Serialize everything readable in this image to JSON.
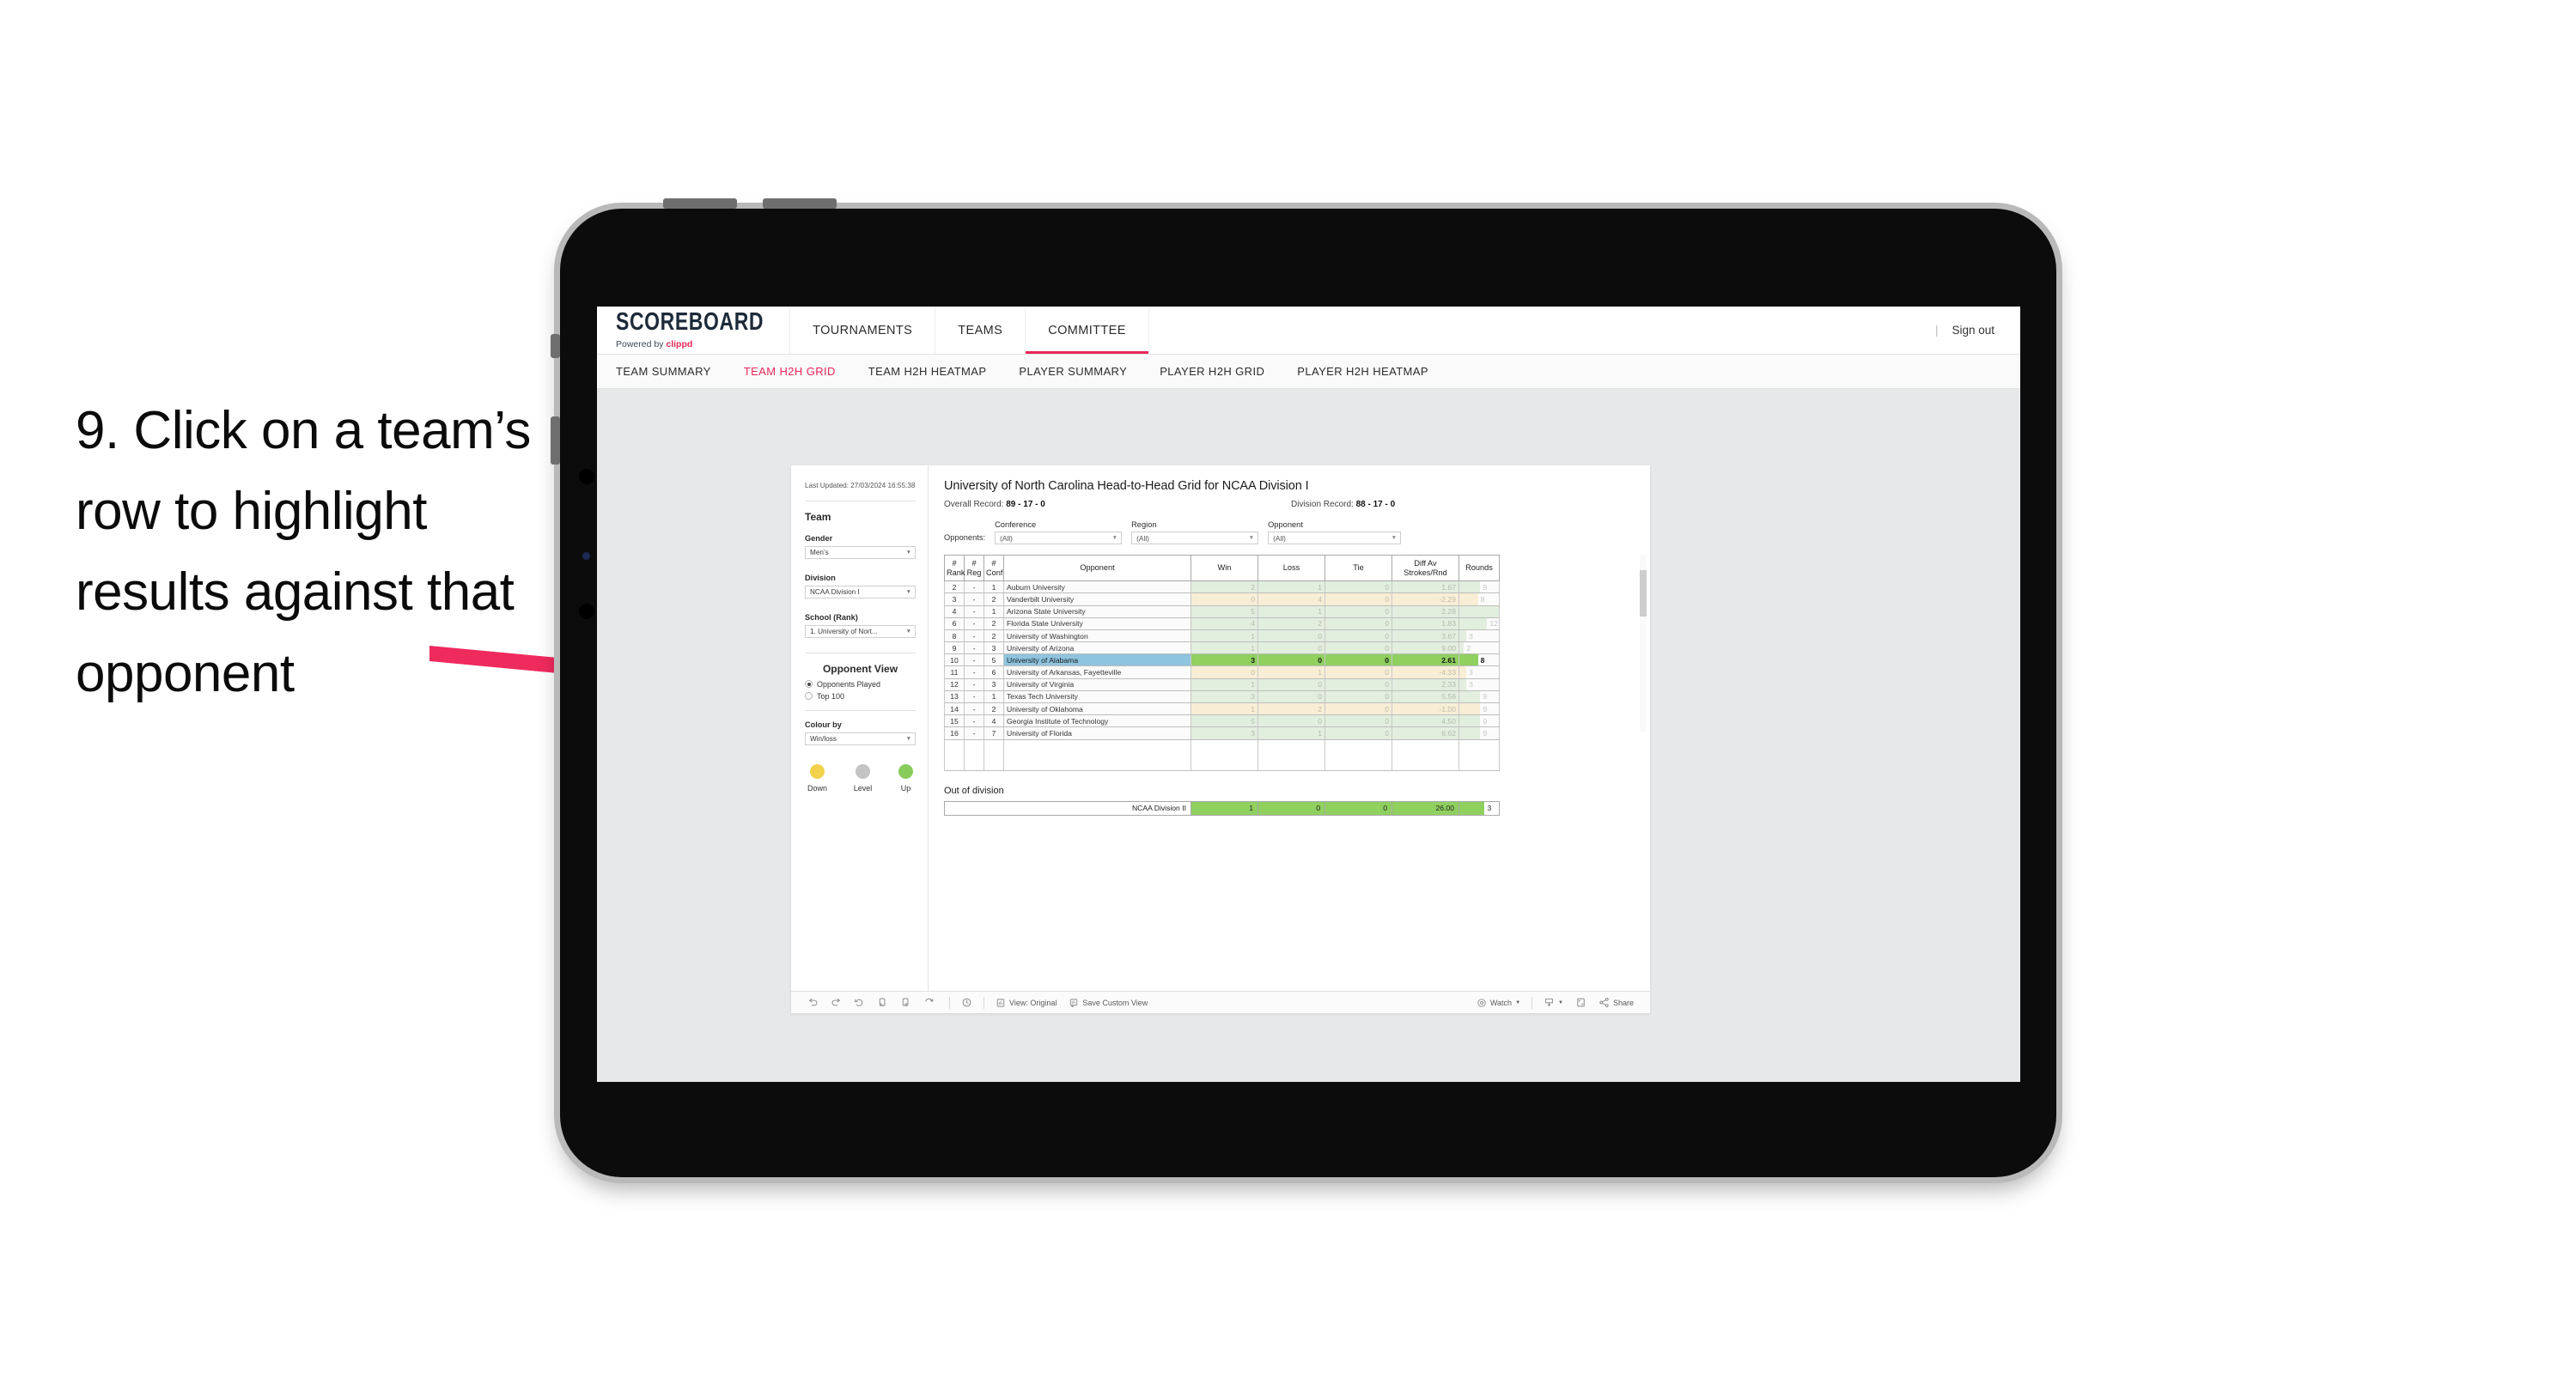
{
  "instruction": {
    "text": "9. Click on a team’s row to highlight results against that opponent",
    "arrow_color": "#ef2a5d"
  },
  "app": {
    "brand": {
      "title": "SCOREBOARD",
      "sub_prefix": "Powered by ",
      "sub_accent": "clippd"
    },
    "top_nav": [
      {
        "label": "TOURNAMENTS",
        "active": false
      },
      {
        "label": "TEAMS",
        "active": false
      },
      {
        "label": "COMMITTEE",
        "active": true
      }
    ],
    "sign_out": "Sign out",
    "divider": "|",
    "sub_nav": [
      {
        "label": "TEAM SUMMARY",
        "active": false
      },
      {
        "label": "TEAM H2H GRID",
        "active": true
      },
      {
        "label": "TEAM H2H HEATMAP",
        "active": false
      },
      {
        "label": "PLAYER SUMMARY",
        "active": false
      },
      {
        "label": "PLAYER H2H GRID",
        "active": false
      },
      {
        "label": "PLAYER H2H HEATMAP",
        "active": false
      }
    ]
  },
  "sidebar": {
    "last_updated": "Last Updated: 27/03/2024 16:55:38",
    "team_heading": "Team",
    "gender_label": "Gender",
    "gender_value": "Men’s",
    "division_label": "Division",
    "division_value": "NCAA Division I",
    "school_label": "School (Rank)",
    "school_value": "1. University of Nort...",
    "opponent_view_heading": "Opponent View",
    "opponent_view_options": [
      {
        "label": "Opponents Played",
        "selected": true
      },
      {
        "label": "Top 100",
        "selected": false
      }
    ],
    "colour_by_label": "Colour by",
    "colour_by_value": "Win/loss",
    "legend": [
      {
        "label": "Down",
        "color": "#f2d24b"
      },
      {
        "label": "Level",
        "color": "#c4c4c4"
      },
      {
        "label": "Up",
        "color": "#89cc5c"
      }
    ]
  },
  "main": {
    "title": "University of North Carolina Head-to-Head Grid for NCAA Division I",
    "overall_record_label": "Overall Record: ",
    "overall_record_value": "89 - 17 - 0",
    "division_record_label": "Division Record: ",
    "division_record_value": "88 - 17 - 0",
    "opponents_label": "Opponents:",
    "filters": [
      {
        "label": "Conference",
        "value": "(All)"
      },
      {
        "label": "Region",
        "value": "(All)"
      },
      {
        "label": "Opponent",
        "value": "(All)"
      }
    ]
  },
  "chart_data": {
    "type": "table",
    "title": "University of North Carolina Head-to-Head Grid for NCAA Division I",
    "columns": [
      "# Rank",
      "# Reg",
      "# Conf",
      "Opponent",
      "Win",
      "Loss",
      "Tie",
      "Diff Av Strokes/Rnd",
      "Rounds"
    ],
    "rounds_axis_max": 17,
    "rows": [
      {
        "rank": "2",
        "reg": "-",
        "conf": "1",
        "opponent": "Auburn University",
        "win": "2",
        "loss": "1",
        "tie": "0",
        "diff": "1.67",
        "rounds": 9,
        "tone": "up",
        "highlighted": false
      },
      {
        "rank": "3",
        "reg": "-",
        "conf": "2",
        "opponent": "Vanderbilt University",
        "win": "0",
        "loss": "4",
        "tie": "0",
        "diff": "-2.29",
        "rounds": 8,
        "tone": "down",
        "highlighted": false
      },
      {
        "rank": "4",
        "reg": "-",
        "conf": "1",
        "opponent": "Arizona State University",
        "win": "5",
        "loss": "1",
        "tie": "0",
        "diff": "2.28",
        "rounds": 17,
        "tone": "up",
        "highlighted": false
      },
      {
        "rank": "6",
        "reg": "-",
        "conf": "2",
        "opponent": "Florida State University",
        "win": "4",
        "loss": "2",
        "tie": "0",
        "diff": "1.83",
        "rounds": 12,
        "tone": "up",
        "highlighted": false
      },
      {
        "rank": "8",
        "reg": "-",
        "conf": "2",
        "opponent": "University of Washington",
        "win": "1",
        "loss": "0",
        "tie": "0",
        "diff": "3.67",
        "rounds": 3,
        "tone": "up",
        "highlighted": false
      },
      {
        "rank": "9",
        "reg": "-",
        "conf": "3",
        "opponent": "University of Arizona",
        "win": "1",
        "loss": "0",
        "tie": "0",
        "diff": "9.00",
        "rounds": 2,
        "tone": "up",
        "highlighted": false
      },
      {
        "rank": "10",
        "reg": "-",
        "conf": "5",
        "opponent": "University of Alabama",
        "win": "3",
        "loss": "0",
        "tie": "0",
        "diff": "2.61",
        "rounds": 8,
        "tone": "up",
        "highlighted": true
      },
      {
        "rank": "11",
        "reg": "-",
        "conf": "6",
        "opponent": "University of Arkansas, Fayetteville",
        "win": "0",
        "loss": "1",
        "tie": "0",
        "diff": "-4.33",
        "rounds": 3,
        "tone": "down",
        "highlighted": false
      },
      {
        "rank": "12",
        "reg": "-",
        "conf": "3",
        "opponent": "University of Virginia",
        "win": "1",
        "loss": "0",
        "tie": "0",
        "diff": "2.33",
        "rounds": 3,
        "tone": "up",
        "highlighted": false
      },
      {
        "rank": "13",
        "reg": "-",
        "conf": "1",
        "opponent": "Texas Tech University",
        "win": "3",
        "loss": "0",
        "tie": "0",
        "diff": "5.56",
        "rounds": 9,
        "tone": "up",
        "highlighted": false
      },
      {
        "rank": "14",
        "reg": "-",
        "conf": "2",
        "opponent": "University of Oklahoma",
        "win": "1",
        "loss": "2",
        "tie": "0",
        "diff": "-1.00",
        "rounds": 9,
        "tone": "down",
        "highlighted": false
      },
      {
        "rank": "15",
        "reg": "-",
        "conf": "4",
        "opponent": "Georgia Institute of Technology",
        "win": "5",
        "loss": "0",
        "tie": "0",
        "diff": "4.50",
        "rounds": 9,
        "tone": "up",
        "highlighted": false
      },
      {
        "rank": "16",
        "reg": "-",
        "conf": "7",
        "opponent": "University of Florida",
        "win": "3",
        "loss": "1",
        "tie": "0",
        "diff": "6.62",
        "rounds": 9,
        "tone": "up",
        "highlighted": false
      }
    ],
    "out_of_division": {
      "title": "Out of division",
      "label": "NCAA Division II",
      "win": "1",
      "loss": "0",
      "tie": "0",
      "diff": "26.00",
      "rounds": "3"
    },
    "colors": {
      "up": "#e2eede",
      "down": "#f7eed5",
      "up_strong": "#8fd05f",
      "highlight_row": "#8ec4de"
    }
  },
  "toolbar": {
    "view_label": "View: Original",
    "save_label": "Save Custom View",
    "watch_label": "Watch",
    "share_label": "Share"
  }
}
